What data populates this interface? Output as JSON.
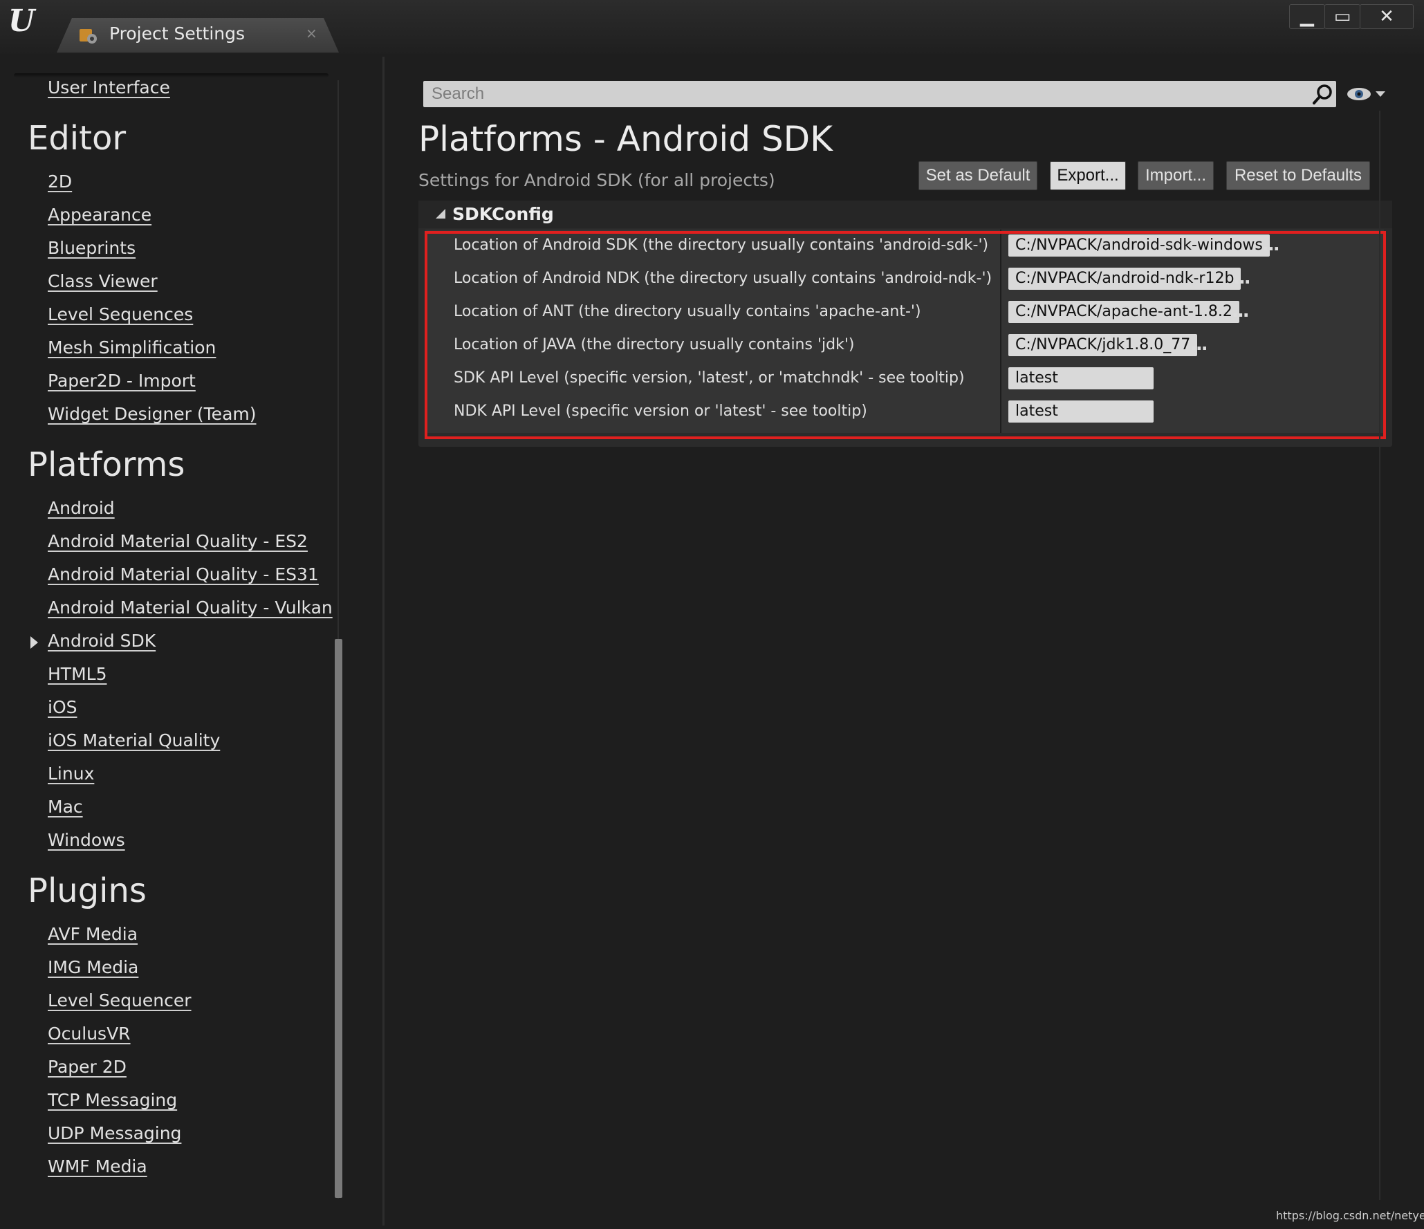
{
  "window": {
    "tab_title": "Project Settings",
    "tab_close": "×",
    "minimize": "▁",
    "maximize": "▭",
    "close": "✕"
  },
  "sidebar": {
    "top_item": "User Interface",
    "sections": [
      {
        "title": "Editor",
        "items": [
          "2D",
          "Appearance",
          "Blueprints",
          "Class Viewer",
          "Level Sequences",
          "Mesh Simplification",
          "Paper2D - Import",
          "Widget Designer (Team)"
        ]
      },
      {
        "title": "Platforms",
        "items": [
          "Android",
          "Android Material Quality - ES2",
          "Android Material Quality - ES31",
          "Android Material Quality - Vulkan",
          "Android SDK",
          "HTML5",
          "iOS",
          "iOS Material Quality",
          "Linux",
          "Mac",
          "Windows"
        ]
      },
      {
        "title": "Plugins",
        "items": [
          "AVF Media",
          "IMG Media",
          "Level Sequencer",
          "OculusVR",
          "Paper 2D",
          "TCP Messaging",
          "UDP Messaging",
          "WMF Media"
        ]
      }
    ],
    "selected": "Android SDK"
  },
  "search": {
    "placeholder": "Search",
    "value": ""
  },
  "main": {
    "title": "Platforms - Android SDK",
    "subtitle": "Settings for Android SDK (for all projects)",
    "buttons": {
      "set_default": "Set as Default",
      "export": "Export...",
      "import": "Import...",
      "reset": "Reset to Defaults"
    },
    "section": {
      "title": "SDKConfig",
      "properties": [
        {
          "label": "Location of Android SDK (the directory usually contains 'android-sdk-')",
          "value": "C:/NVPACK/android-sdk-windows",
          "browse": "..."
        },
        {
          "label": "Location of Android NDK (the directory usually contains 'android-ndk-')",
          "value": "C:/NVPACK/android-ndk-r12b",
          "browse": "..."
        },
        {
          "label": "Location of ANT (the directory usually contains 'apache-ant-')",
          "value": "C:/NVPACK/apache-ant-1.8.2",
          "browse": "..."
        },
        {
          "label": "Location of JAVA (the directory usually contains 'jdk')",
          "value": "C:/NVPACK/jdk1.8.0_77",
          "browse": "..."
        },
        {
          "label": "SDK API Level (specific version, 'latest', or 'matchndk' - see tooltip)",
          "value": "latest"
        },
        {
          "label": "NDK API Level (specific version or 'latest' - see tooltip)",
          "value": "latest"
        }
      ]
    }
  },
  "watermark": "https://blog.csdn.net/netyeaxi",
  "colors": {
    "background": "#1e1e1e",
    "highlight": "#e0201f",
    "field": "#d9d9d9"
  }
}
